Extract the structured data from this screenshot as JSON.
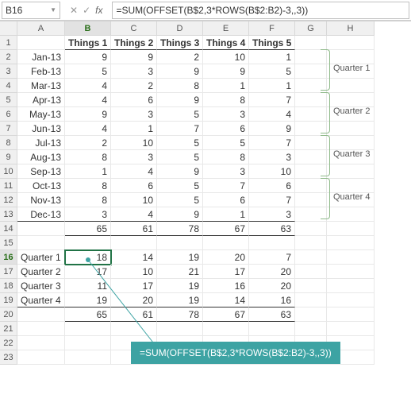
{
  "namebox": {
    "value": "B16"
  },
  "formula_bar": {
    "value": "=SUM(OFFSET(B$2,3*ROWS(B$2:B2)-3,,3))"
  },
  "icons": {
    "cancel": "✕",
    "confirm": "✓",
    "fx": "fx"
  },
  "columns": [
    "A",
    "B",
    "C",
    "D",
    "E",
    "F",
    "G",
    "H"
  ],
  "header_row": [
    "",
    "Things 1",
    "Things 2",
    "Things 3",
    "Things 4",
    "Things 5",
    "",
    ""
  ],
  "months": [
    {
      "label": "Jan-13",
      "v": [
        9,
        9,
        2,
        10,
        1
      ]
    },
    {
      "label": "Feb-13",
      "v": [
        5,
        3,
        9,
        9,
        5
      ]
    },
    {
      "label": "Mar-13",
      "v": [
        4,
        2,
        8,
        1,
        1
      ]
    },
    {
      "label": "Apr-13",
      "v": [
        4,
        6,
        9,
        8,
        7
      ]
    },
    {
      "label": "May-13",
      "v": [
        9,
        3,
        5,
        3,
        4
      ]
    },
    {
      "label": "Jun-13",
      "v": [
        4,
        1,
        7,
        6,
        9
      ]
    },
    {
      "label": "Jul-13",
      "v": [
        2,
        10,
        5,
        5,
        7
      ]
    },
    {
      "label": "Aug-13",
      "v": [
        8,
        3,
        5,
        8,
        3
      ]
    },
    {
      "label": "Sep-13",
      "v": [
        1,
        4,
        9,
        3,
        10
      ]
    },
    {
      "label": "Oct-13",
      "v": [
        8,
        6,
        5,
        7,
        6
      ]
    },
    {
      "label": "Nov-13",
      "v": [
        8,
        10,
        5,
        6,
        7
      ]
    },
    {
      "label": "Dec-13",
      "v": [
        3,
        4,
        9,
        1,
        3
      ]
    }
  ],
  "month_totals": [
    65,
    61,
    78,
    67,
    63
  ],
  "quarter_labels": [
    "Quarter 1",
    "Quarter 2",
    "Quarter 3",
    "Quarter 4"
  ],
  "quarters": [
    {
      "label": "Quarter 1",
      "v": [
        18,
        14,
        19,
        20,
        7
      ]
    },
    {
      "label": "Quarter 2",
      "v": [
        17,
        10,
        21,
        17,
        20
      ]
    },
    {
      "label": "Quarter 3",
      "v": [
        11,
        17,
        19,
        16,
        20
      ]
    },
    {
      "label": "Quarter 4",
      "v": [
        19,
        20,
        19,
        14,
        16
      ]
    }
  ],
  "quarter_totals": [
    65,
    61,
    78,
    67,
    63
  ],
  "callout": {
    "text": "=SUM(OFFSET(B$2,3*ROWS(B$2:B2)-3,,3))"
  },
  "selected_cell": "B16"
}
